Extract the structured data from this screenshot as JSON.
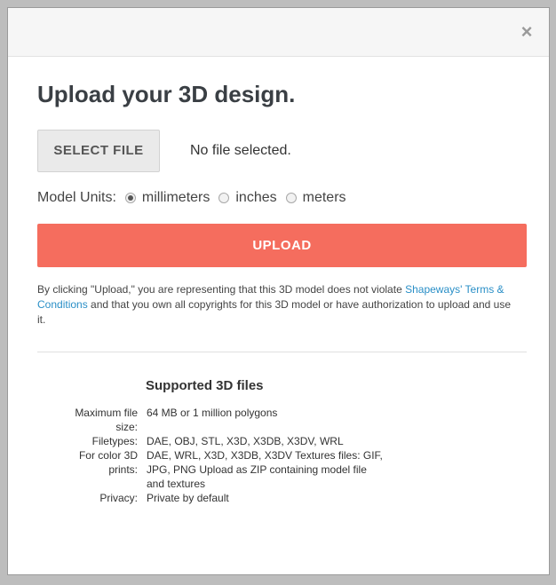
{
  "modal": {
    "close_symbol": "×",
    "title": "Upload your 3D design.",
    "select_file_label": "SELECT FILE",
    "file_status": "No file selected.",
    "units": {
      "label": "Model Units:",
      "options": [
        "millimeters",
        "inches",
        "meters"
      ],
      "selected": "millimeters"
    },
    "upload_label": "UPLOAD",
    "disclaimer": {
      "before": "By clicking \"Upload,\" you are representing that this 3D model does not violate",
      "link": "Shapeways' Terms & Conditions",
      "after": "and that you own all copyrights for this 3D model or have authorization to upload and use it."
    },
    "supported": {
      "title": "Supported 3D files",
      "rows": [
        {
          "key": "Maximum file size:",
          "value": "64 MB or 1 million polygons"
        },
        {
          "key": "Filetypes:",
          "value": "DAE, OBJ, STL, X3D, X3DB, X3DV, WRL"
        },
        {
          "key": "For color 3D prints:",
          "value": "DAE, WRL, X3D, X3DB, X3DV Textures files: GIF, JPG, PNG Upload as ZIP containing model file and textures"
        },
        {
          "key": "Privacy:",
          "value": "Private by default"
        }
      ]
    }
  }
}
